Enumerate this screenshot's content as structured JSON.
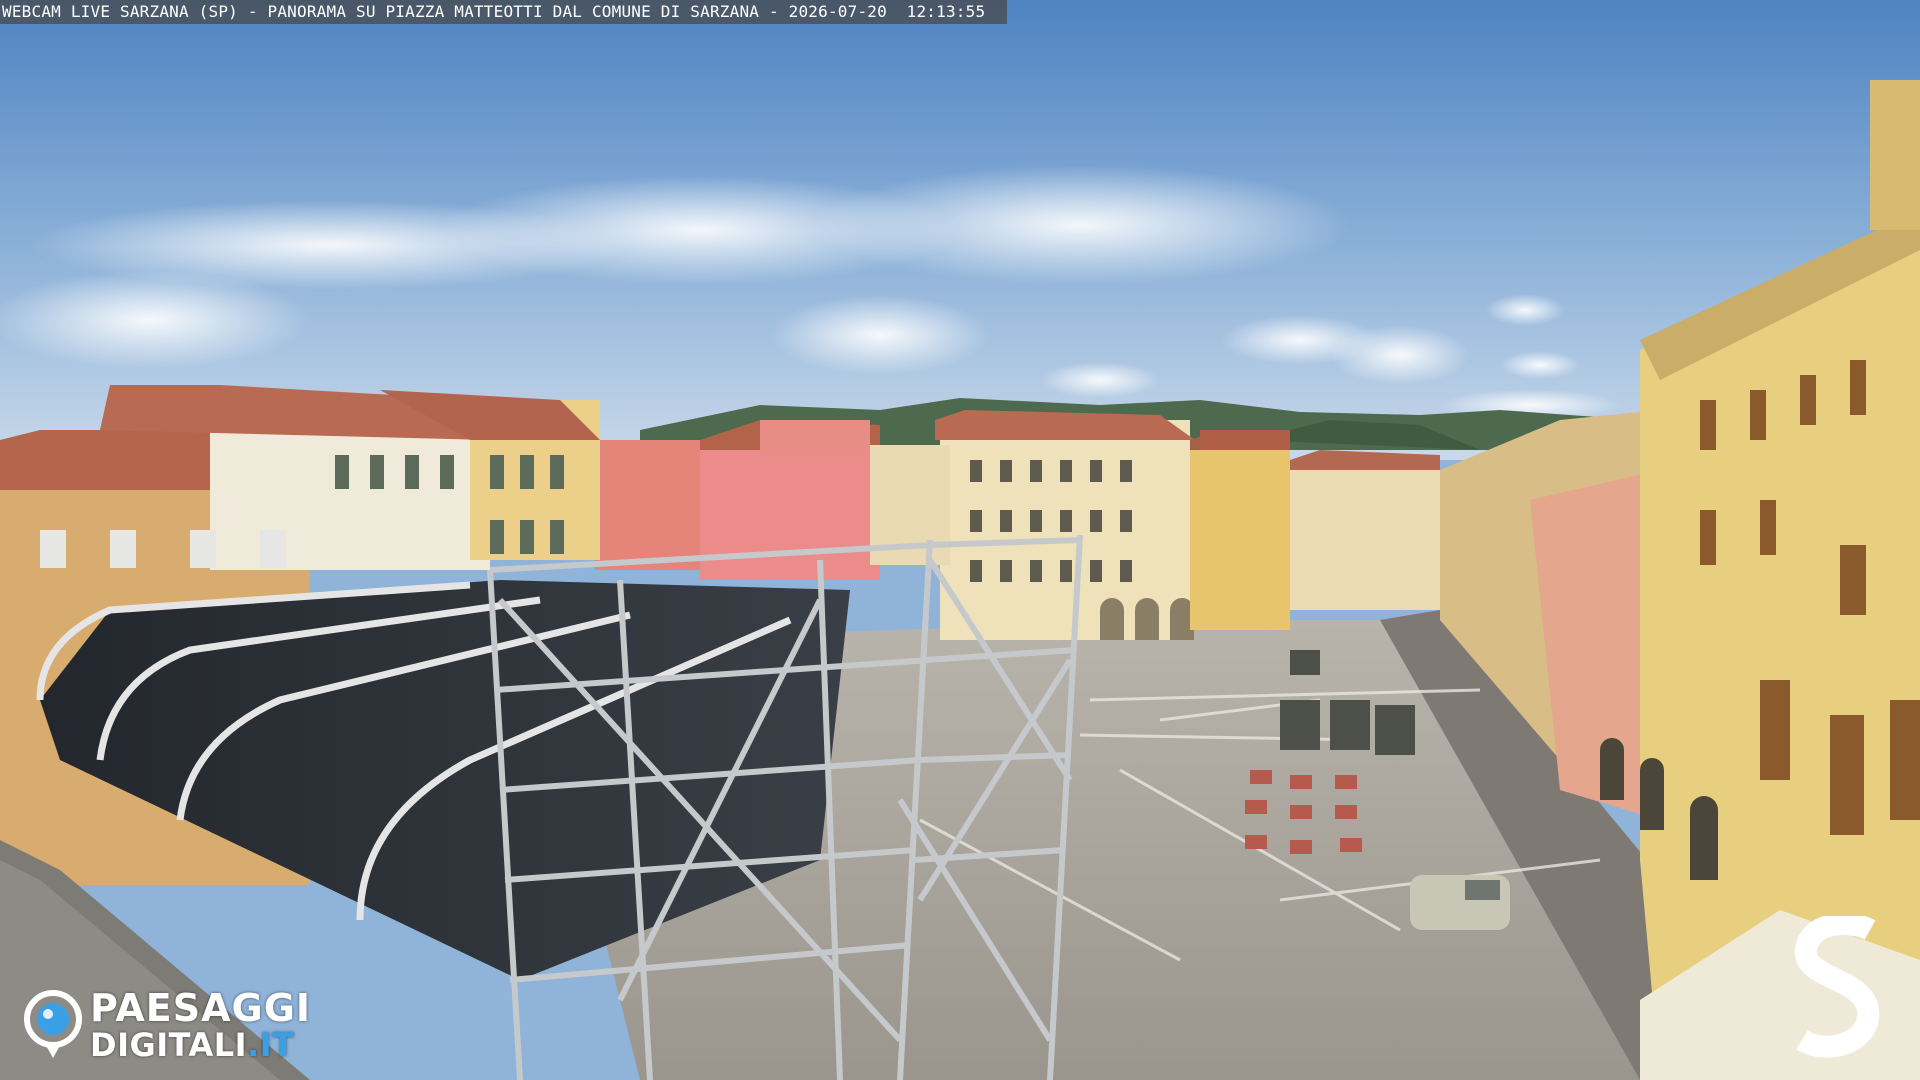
{
  "overlay": {
    "caption": "WEBCAM LIVE SARZANA (SP) - PANORAMA SU PIAZZA MATTEOTTI DAL COMUNE DI SARZANA - 2026-07-20  12:13:55",
    "logo_line1": "PAESAGGI",
    "logo_line2": "DIGITALI",
    "logo_tld": ".IT"
  },
  "colors": {
    "sky_top": "#5f8fc7",
    "sky_bottom": "#b9d0e6",
    "terracotta": "#b5654c",
    "pavement": "#a9a59c",
    "stage_cover": "#2b2f36",
    "logo_blue": "#3aa0e6"
  },
  "icons": {
    "left_logo": "camera-eye-icon",
    "right_logo": "s-brand-icon"
  }
}
